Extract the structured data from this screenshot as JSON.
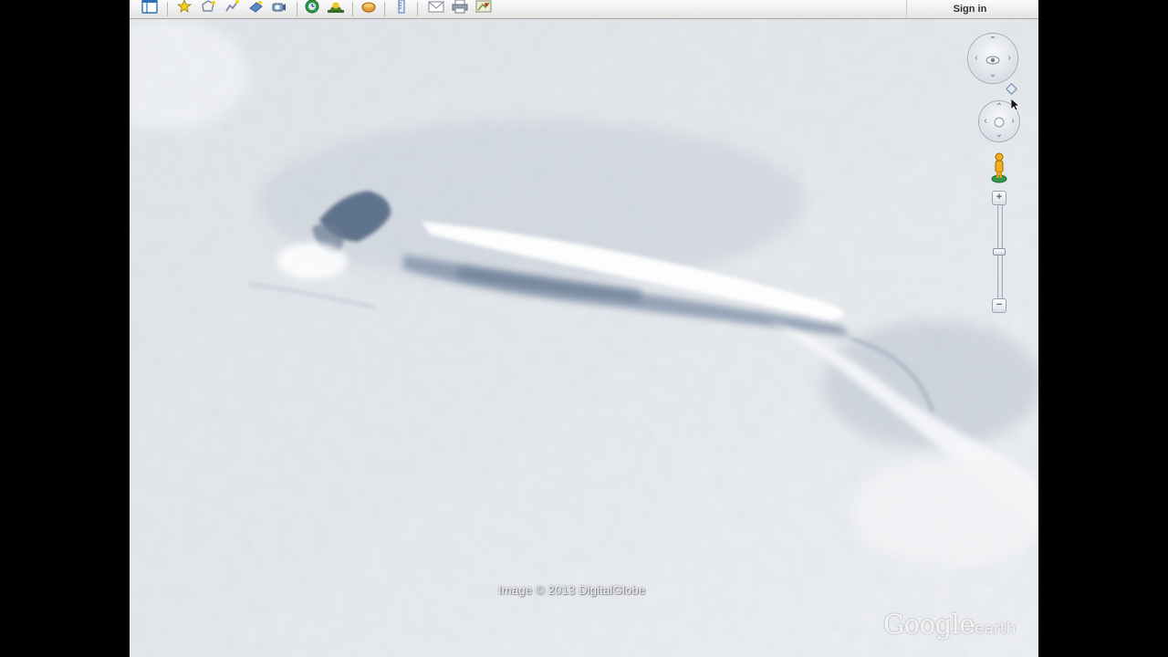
{
  "toolbar": {
    "buttons": [
      {
        "name": "sidebar-toggle",
        "icon": "sidebar-icon"
      },
      {
        "name": "add-placemark",
        "icon": "pushpin-icon"
      },
      {
        "name": "add-polygon",
        "icon": "polygon-icon"
      },
      {
        "name": "add-path",
        "icon": "path-icon"
      },
      {
        "name": "add-image-overlay",
        "icon": "image-overlay-icon"
      },
      {
        "name": "record-tour",
        "icon": "record-tour-icon"
      },
      {
        "name": "historical-imagery",
        "icon": "clock-globe-icon"
      },
      {
        "name": "sunlight",
        "icon": "sunlight-icon"
      },
      {
        "name": "switch-planets",
        "icon": "planet-icon"
      },
      {
        "name": "ruler",
        "icon": "ruler-icon"
      },
      {
        "name": "email",
        "icon": "envelope-icon"
      },
      {
        "name": "print",
        "icon": "printer-icon"
      },
      {
        "name": "view-in-google-maps",
        "icon": "maps-icon"
      }
    ],
    "sign_in_label": "Sign in"
  },
  "map": {
    "imagery_credit": "Image © 2013 DigitalGlobe",
    "logo_primary": "Google",
    "logo_secondary": "earth"
  },
  "navigation": {
    "look_control": "look-joystick",
    "move_control": "move-joystick",
    "zoom_in_label": "+",
    "zoom_out_label": "−",
    "zoom_level": 0.5
  },
  "colors": {
    "snow": "#e8ebef",
    "shadow": "#6d7f95"
  }
}
